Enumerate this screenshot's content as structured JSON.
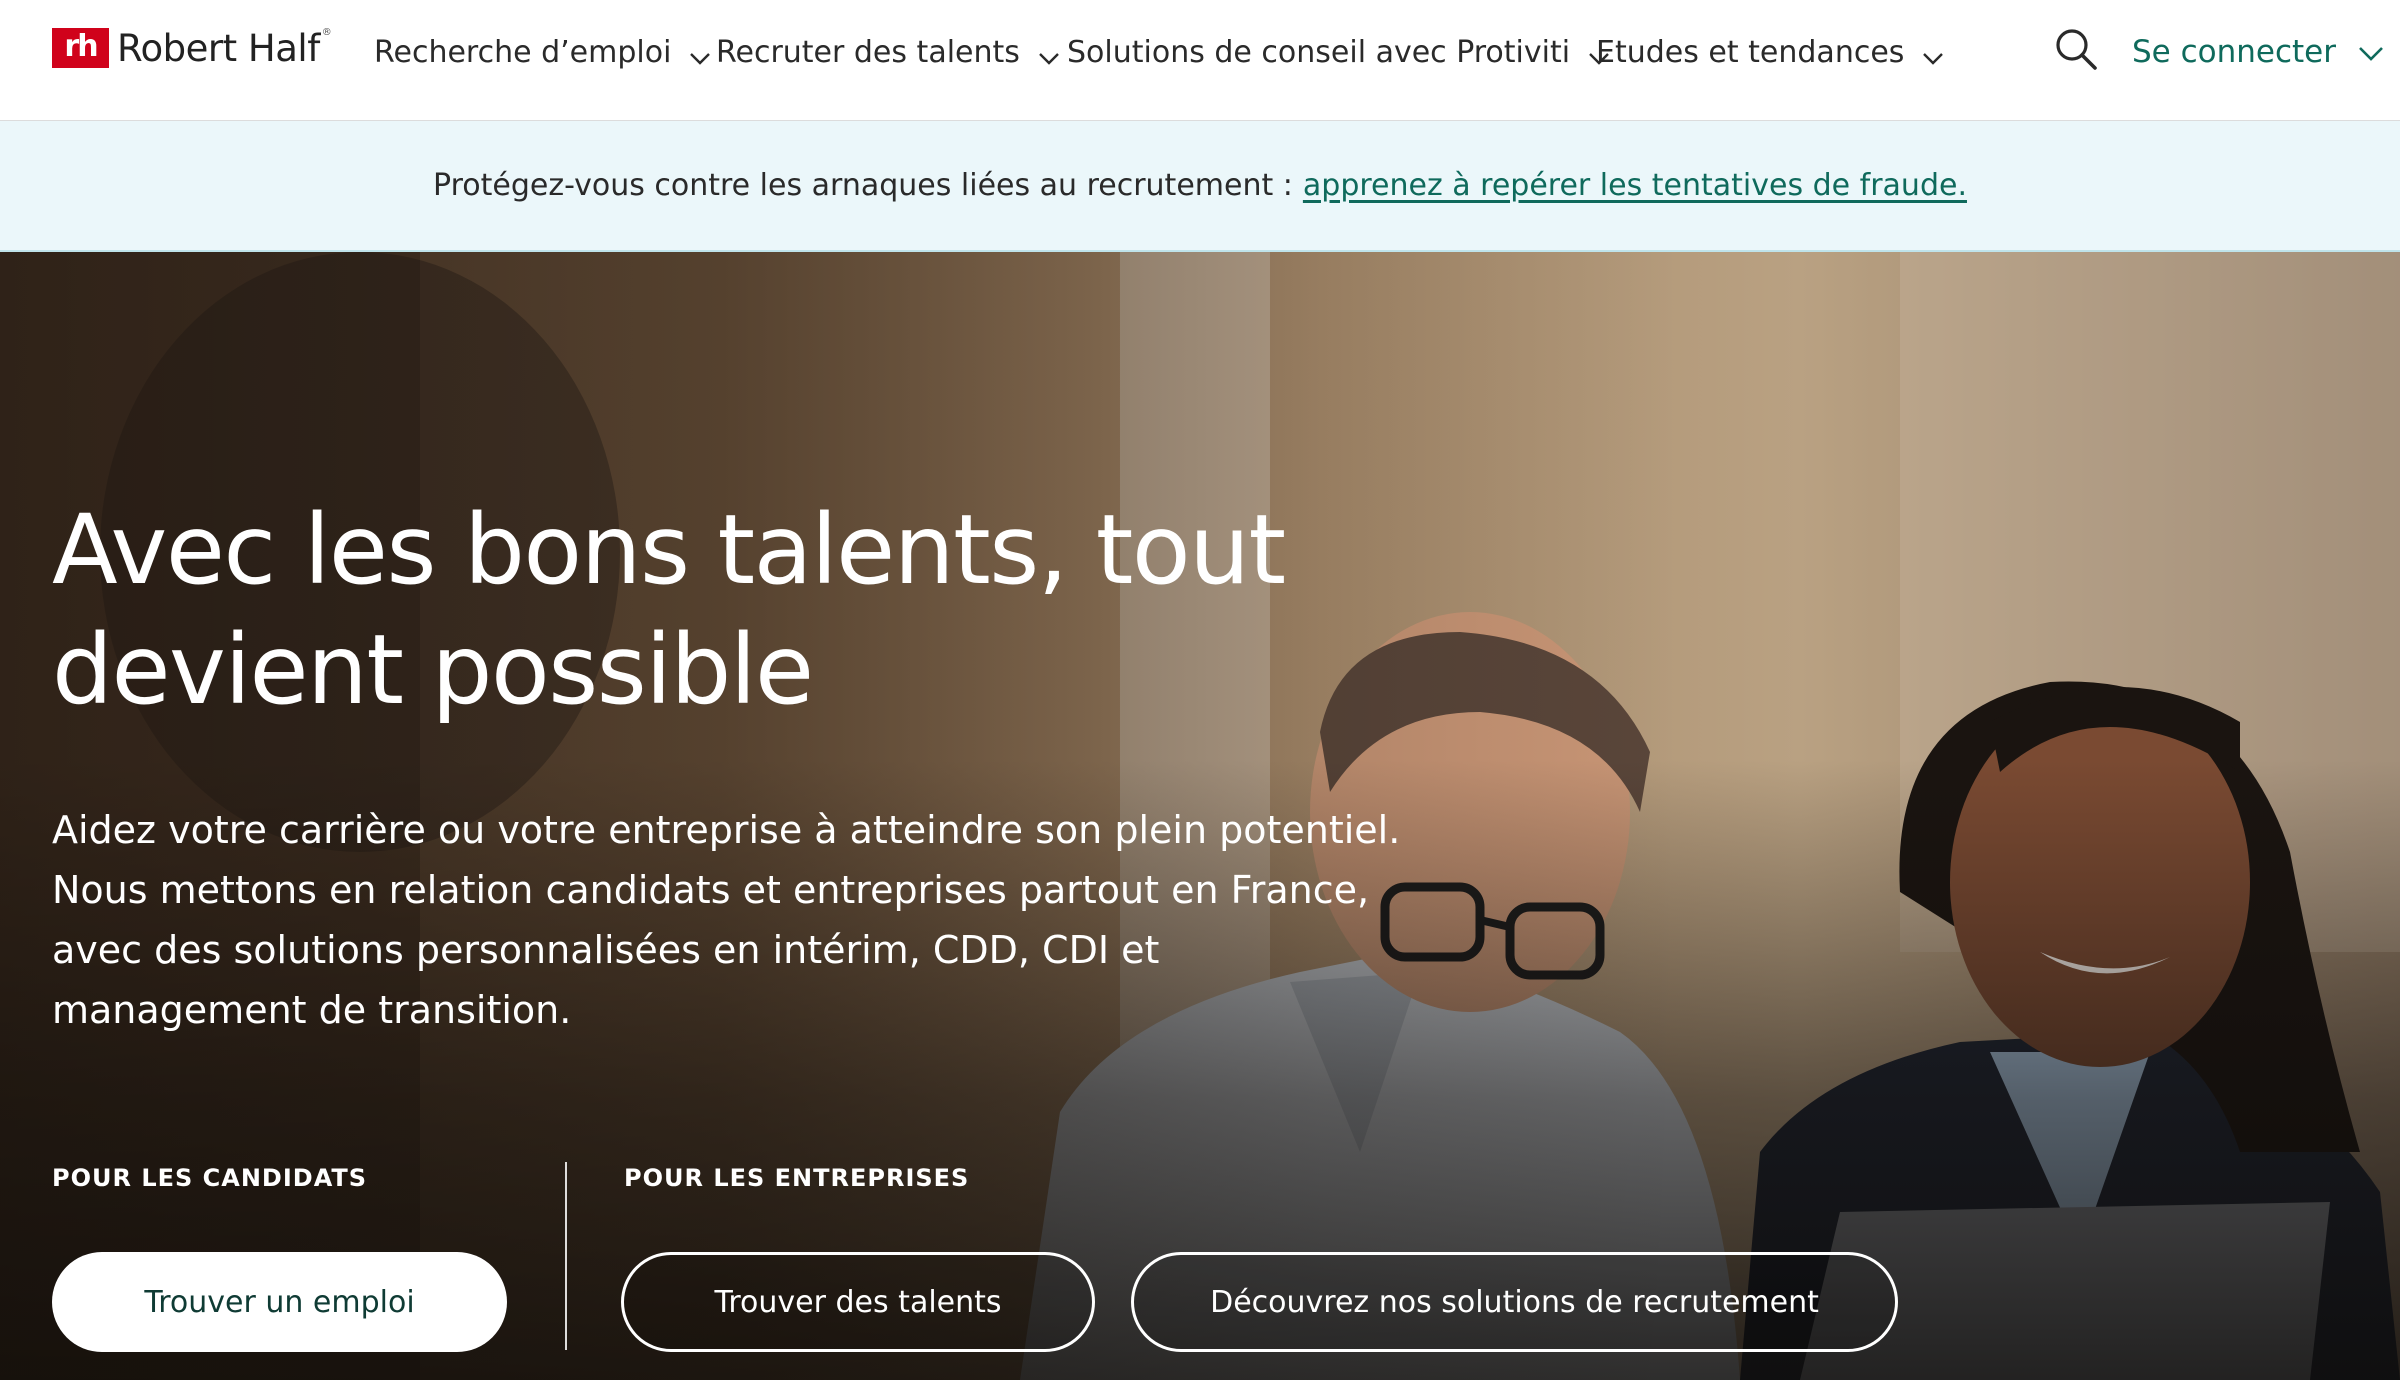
{
  "header": {
    "logo_mark": "rh",
    "logo_text": "Robert Half",
    "logo_reg": "®",
    "nav": [
      {
        "label": "Recherche d’emploi"
      },
      {
        "label": "Recruter des talents"
      },
      {
        "label": "Solutions de conseil avec Protiviti"
      },
      {
        "label": "Etudes et tendances"
      }
    ],
    "search_icon": "search-icon",
    "login_label": "Se connecter"
  },
  "alert": {
    "text": "Protégez-vous contre les arnaques liées au recrutement :",
    "link": "apprenez à repérer les tentatives de fraude."
  },
  "hero": {
    "title_line1": "Avec les bons talents, tout",
    "title_line2": "devient possible",
    "text_lines": [
      "Aidez votre carrière ou votre entreprise à atteindre son plein potentiel.",
      "Nous mettons en relation candidats et entreprises partout en France,",
      "avec des solutions personnalisées en intérim, CDD, CDI et",
      "management de transition."
    ],
    "candidates_label": "POUR LES CANDIDATS",
    "companies_label": "POUR LES ENTREPRISES",
    "btn_find_job": "Trouver un emploi",
    "btn_find_talents": "Trouver des talents",
    "btn_solutions": "Découvrez nos solutions de recrutement"
  },
  "colors": {
    "brand_red": "#d0021b",
    "accent_green": "#0f6a5c",
    "alert_bg": "#ebf7fa"
  }
}
